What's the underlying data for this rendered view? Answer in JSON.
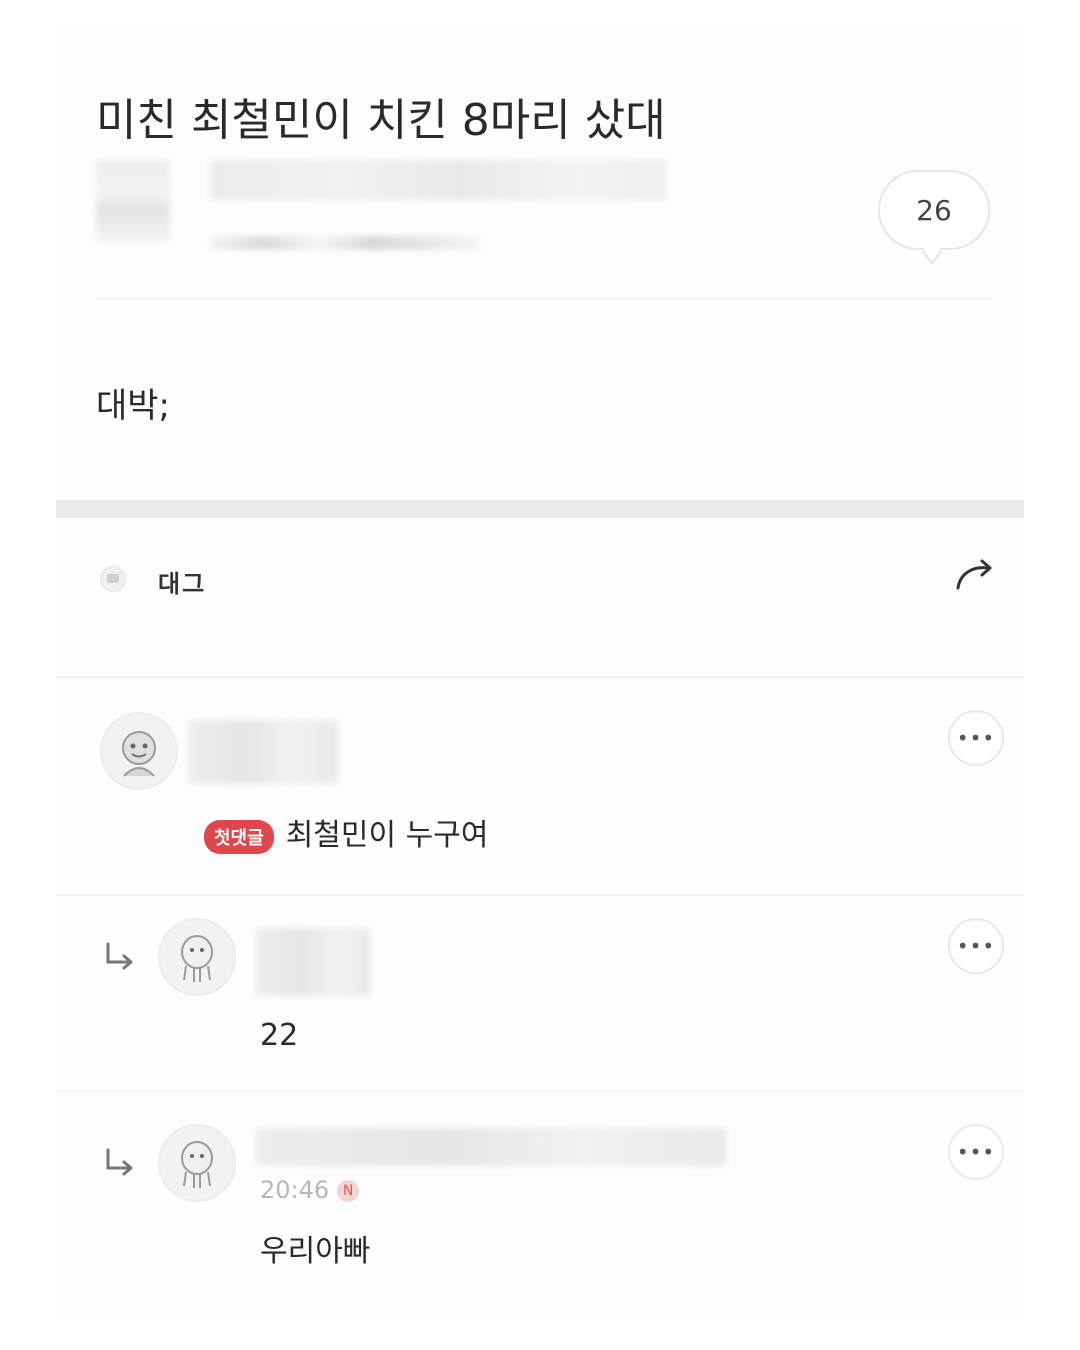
{
  "post": {
    "title": "미친 최철민이 치킨 8마리 샀대",
    "comment_count": "26",
    "body": "대박;"
  },
  "comments_section": {
    "header_label": "대그"
  },
  "comments": [
    {
      "badge": "첫댓글",
      "text": "최철민이 누구여"
    },
    {
      "text": "22"
    },
    {
      "timestamp": "20:46",
      "new_mark": "N",
      "text": "우리아빠"
    }
  ]
}
